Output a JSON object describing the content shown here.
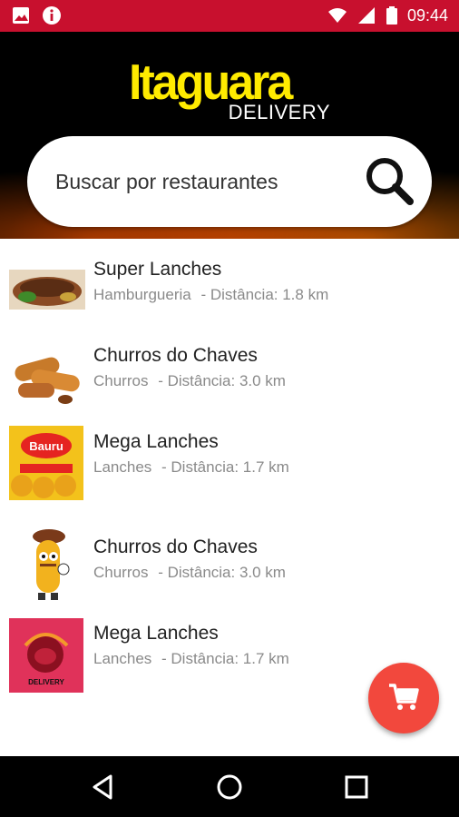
{
  "status_bar": {
    "time": "09:44"
  },
  "header": {
    "brand": "Itaguara",
    "brand_sub": "DELIVERY"
  },
  "search": {
    "placeholder": "Buscar por restaurantes"
  },
  "restaurants": [
    {
      "name": "Super Lanches",
      "category": "Hamburgueria",
      "distance": "- Distância: 1.8 km"
    },
    {
      "name": "Churros do Chaves",
      "category": "Churros",
      "distance": "- Distância: 3.0 km"
    },
    {
      "name": "Mega Lanches",
      "category": "Lanches",
      "distance": "- Distância: 1.7 km"
    },
    {
      "name": "Churros do Chaves",
      "category": "Churros",
      "distance": "- Distância: 3.0 km"
    },
    {
      "name": "Mega Lanches",
      "category": "Lanches",
      "distance": "- Distância: 1.7 km"
    }
  ],
  "thumb_text": {
    "bauru": "Bauru",
    "delivery": "DELIVERY"
  },
  "icons": {
    "status_left": [
      "image-icon",
      "info-icon"
    ],
    "status_right": [
      "wifi-icon",
      "signal-icon",
      "battery-icon"
    ],
    "search": "search-icon",
    "fab": "cart-icon",
    "nav": [
      "back-icon",
      "home-icon",
      "recents-icon"
    ]
  },
  "colors": {
    "status_bar": "#c8102e",
    "brand_yellow": "#ffeb00",
    "fab": "#f2483d",
    "text_secondary": "#8a8a8a"
  }
}
